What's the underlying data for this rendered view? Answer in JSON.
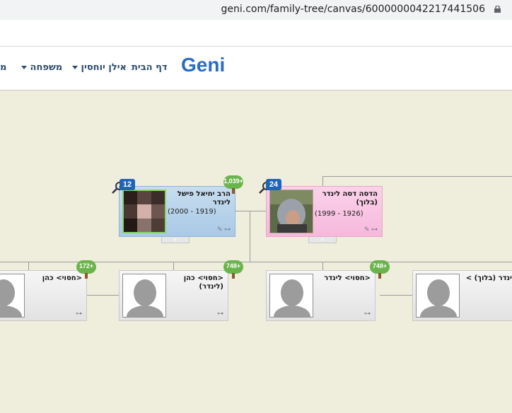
{
  "browser": {
    "url": "geni.com/family-tree/canvas/6000000042217441506"
  },
  "nav": {
    "logo": "Geni",
    "home": "דף הבית",
    "user": "אילן יוחסין",
    "family": "משפחה",
    "partial": "מ"
  },
  "focus_person": {
    "name": "הרב יחיאל פישל לינדר",
    "dates": "(2000 - 1919)",
    "photos_count": "12",
    "tree_count": "1,039+"
  },
  "spouse": {
    "name": "הדסה דסה לינדר (בלוך)",
    "dates": "(1999 - 1926)",
    "photos_count": "24"
  },
  "children": [
    {
      "name": "<חסוי> כהן",
      "tree_count": "172+"
    },
    {
      "name": "<חסוי> כהן (לינדר)",
      "tree_count": "748+"
    },
    {
      "name": "<חסוי> לינדר",
      "tree_count": "748+"
    },
    {
      "name": "לינדר (בלוך) >"
    }
  ],
  "colors": {
    "nav_text": "#2d4a6e",
    "canvas": "#efeedd",
    "badge": "#1f64b7",
    "tree": "#6bb44c"
  }
}
